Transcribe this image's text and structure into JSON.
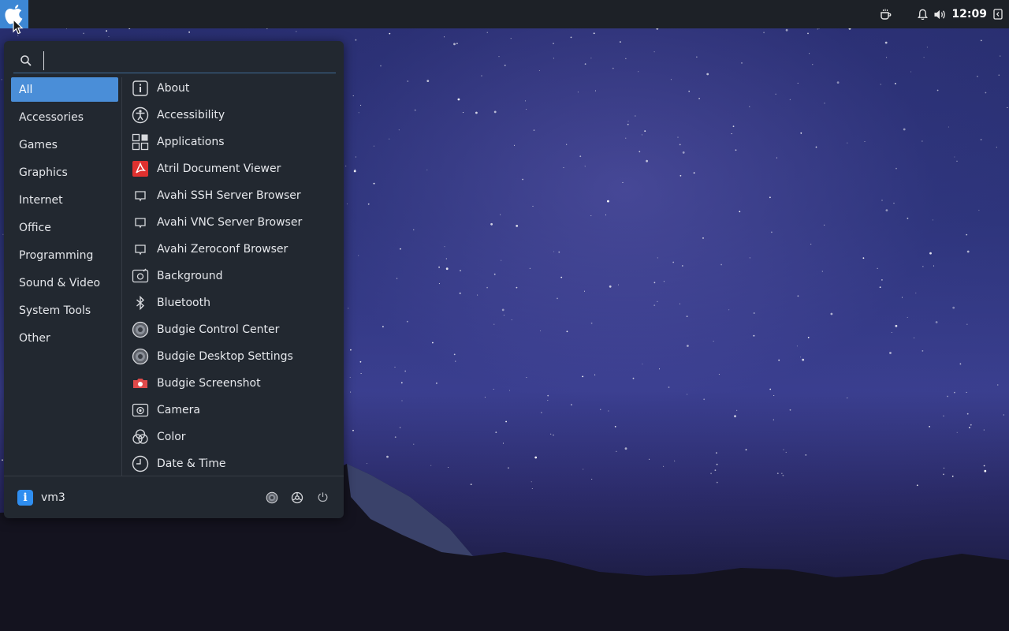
{
  "panel": {
    "menu_icon": "apple-logo-icon",
    "tray": {
      "caffeine_icon": "coffee-cup-icon",
      "notification_icon": "bell-icon",
      "volume_icon": "speaker-icon",
      "clock": "12:09",
      "raven_icon": "sidebar-toggle-icon"
    }
  },
  "menu": {
    "search": {
      "value": "",
      "placeholder": ""
    },
    "categories": [
      {
        "label": "All",
        "selected": true
      },
      {
        "label": "Accessories"
      },
      {
        "label": "Games"
      },
      {
        "label": "Graphics"
      },
      {
        "label": "Internet"
      },
      {
        "label": "Office"
      },
      {
        "label": "Programming"
      },
      {
        "label": "Sound & Video"
      },
      {
        "label": "System Tools"
      },
      {
        "label": "Other"
      }
    ],
    "apps": [
      {
        "label": "About",
        "icon": "info-icon"
      },
      {
        "label": "Accessibility",
        "icon": "accessibility-icon"
      },
      {
        "label": "Applications",
        "icon": "applications-grid-icon"
      },
      {
        "label": "Atril Document Viewer",
        "icon": "pdf-viewer-icon"
      },
      {
        "label": "Avahi SSH Server Browser",
        "icon": "window-icon"
      },
      {
        "label": "Avahi VNC Server Browser",
        "icon": "window-icon"
      },
      {
        "label": "Avahi Zeroconf Browser",
        "icon": "window-icon"
      },
      {
        "label": "Background",
        "icon": "background-icon"
      },
      {
        "label": "Bluetooth",
        "icon": "bluetooth-icon"
      },
      {
        "label": "Budgie Control Center",
        "icon": "budgie-settings-icon"
      },
      {
        "label": "Budgie Desktop Settings",
        "icon": "budgie-settings-icon"
      },
      {
        "label": "Budgie Screenshot",
        "icon": "camera-screenshot-icon"
      },
      {
        "label": "Camera",
        "icon": "camera-icon"
      },
      {
        "label": "Color",
        "icon": "color-icon"
      },
      {
        "label": "Date & Time",
        "icon": "clock-icon"
      }
    ],
    "footer": {
      "user_name": "vm3",
      "user_avatar_letter": "i",
      "actions": [
        "budgie-settings-icon",
        "system-settings-icon",
        "power-icon"
      ]
    }
  },
  "colors": {
    "accent": "#4a8ed8",
    "panel_bg": "#1d2127",
    "menu_bg": "#222830"
  }
}
